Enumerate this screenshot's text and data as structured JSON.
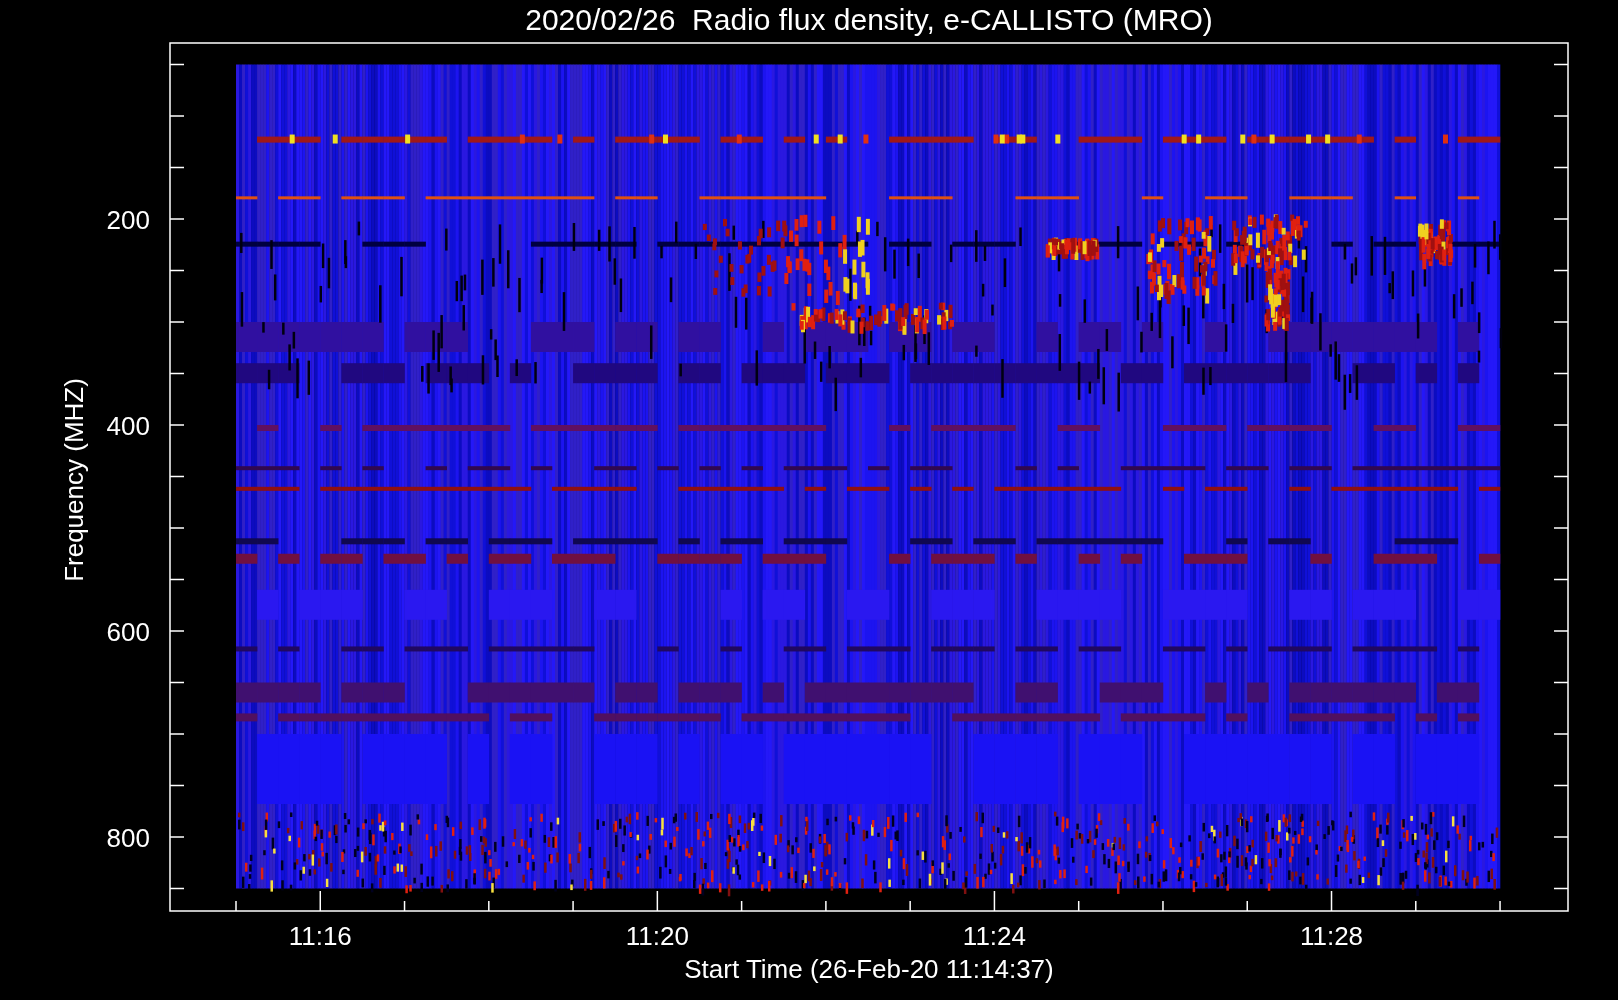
{
  "title": "2020/02/26  Radio flux density, e-CALLISTO (MRO)",
  "y_axis": {
    "label": "Frequency (MHZ)",
    "ticks": [
      "200",
      "400",
      "600",
      "800"
    ]
  },
  "x_axis": {
    "label": "Start Time (26-Feb-20 11:14:37)",
    "ticks": [
      "11:16",
      "11:20",
      "11:24",
      "11:28"
    ]
  }
}
